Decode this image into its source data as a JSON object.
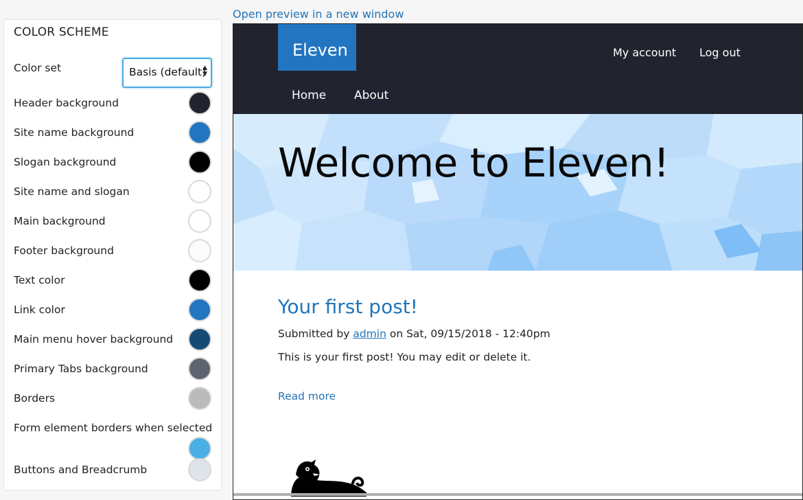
{
  "color_scheme": {
    "title": "COLOR SCHEME",
    "color_set_label": "Color set",
    "color_set_value": "Basis (default)",
    "fields": [
      {
        "label": "Header background",
        "color": "#21242f"
      },
      {
        "label": "Site name background",
        "color": "#2275c0"
      },
      {
        "label": "Slogan background",
        "color": "#000000"
      },
      {
        "label": "Site name and slogan",
        "color": "#ffffff"
      },
      {
        "label": "Main background",
        "color": "#ffffff"
      },
      {
        "label": "Footer background",
        "color": "#fbfbfb"
      },
      {
        "label": "Text color",
        "color": "#000000"
      },
      {
        "label": "Link color",
        "color": "#2275c0"
      },
      {
        "label": "Main menu hover background",
        "color": "#164a75"
      },
      {
        "label": "Primary Tabs background",
        "color": "#5e6370"
      },
      {
        "label": "Borders",
        "color": "#bbbbbb"
      },
      {
        "label": "Form element borders when selected",
        "color": "#49afe5"
      },
      {
        "label": "Buttons and Breadcrumb",
        "color": "#dfe3ea"
      }
    ]
  },
  "preview": {
    "open_link": "Open preview in a new window",
    "site_name": "Eleven",
    "account_links": [
      "My account",
      "Log out"
    ],
    "main_menu": [
      "Home",
      "About"
    ],
    "hero_title": "Welcome to Eleven!",
    "post": {
      "title": "Your first post!",
      "meta_prefix": "Submitted by",
      "author": "admin",
      "meta_suffix": "on Sat, 09/15/2018 - 12:40pm",
      "body": "This is your first post! You may edit or delete it.",
      "read_more": "Read more"
    },
    "footer_logo_icon": "druplicon-icon"
  }
}
